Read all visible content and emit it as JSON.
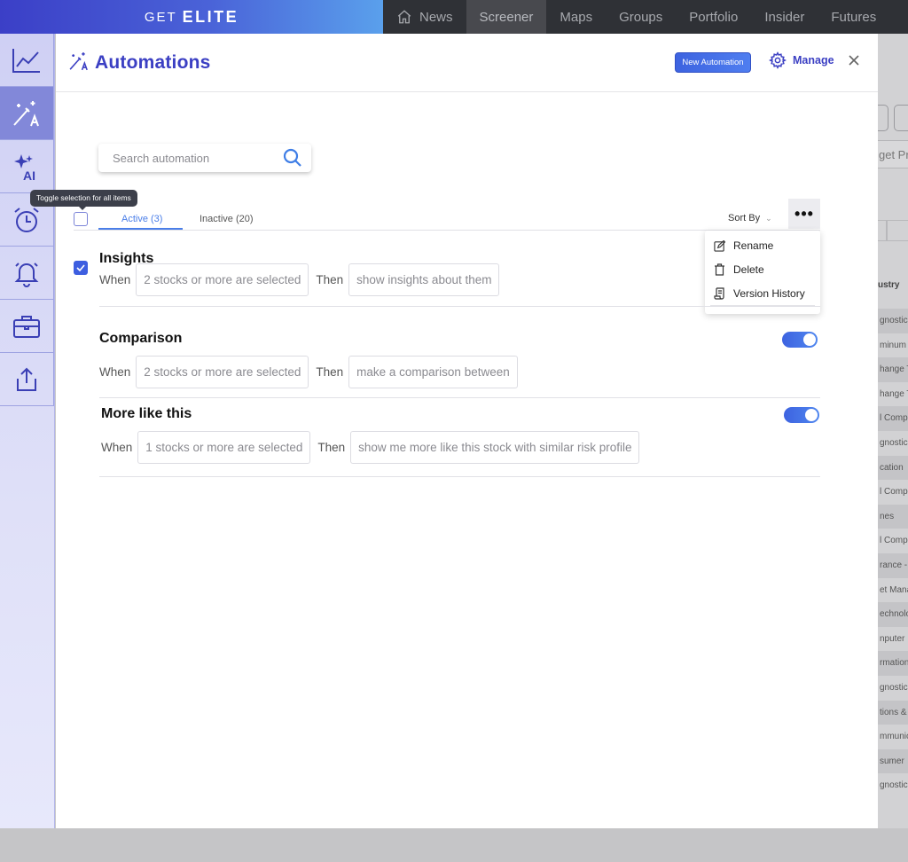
{
  "topbar": {
    "brand_small": "GET",
    "brand_big": "ELITE",
    "nav": [
      {
        "label": "News",
        "icon": "home-icon"
      },
      {
        "label": "Screener",
        "active": true
      },
      {
        "label": "Maps"
      },
      {
        "label": "Groups"
      },
      {
        "label": "Portfolio"
      },
      {
        "label": "Insider"
      },
      {
        "label": "Futures"
      }
    ]
  },
  "sidebar": {
    "items": [
      {
        "icon": "chart-line-icon"
      },
      {
        "icon": "magic-wand-icon",
        "active": true
      },
      {
        "icon": "ai-sparkle-icon"
      },
      {
        "icon": "alarm-clock-icon"
      },
      {
        "icon": "bell-icon"
      },
      {
        "icon": "briefcase-icon"
      },
      {
        "icon": "share-upload-icon"
      }
    ]
  },
  "modal": {
    "title": "Automations",
    "new_button": "New Automation",
    "manage_label": "Manage",
    "search_placeholder": "Search automation",
    "tooltip": "Toggle selection for all items",
    "tabs": {
      "active": "Active (3)",
      "inactive": "Inactive (20)"
    },
    "sort_by": "Sort By",
    "menu": {
      "rename": "Rename",
      "delete": "Delete",
      "version_history": "Version History"
    },
    "when_label": "When",
    "then_label": "Then",
    "automations": [
      {
        "name": "Insights",
        "when": "2 stocks or more are selected",
        "then": "show insights about them",
        "selected": true
      },
      {
        "name": "Comparison",
        "when": "2 stocks or more are selected",
        "then": "make a comparison between",
        "enabled": true
      },
      {
        "name": "More like this",
        "when": "1 stocks or more are selected",
        "then": "show me more like this stock with similar risk profile",
        "enabled": true
      }
    ]
  },
  "background": {
    "search_fragment": "get Pr",
    "column_header": "ustry",
    "column_cells": [
      "gnostics",
      "minum",
      "hange T",
      "hange T",
      "l Comp",
      "gnostics",
      "cation",
      "l Comp",
      "nes",
      "l Comp",
      "rance -",
      "et Mana",
      "echnolo",
      "nputer",
      "rmation",
      "gnostics",
      "tions &",
      "mmunic",
      "sumer",
      "gnostics"
    ]
  },
  "colors": {
    "accent": "#3b3fc3",
    "primary": "#4a7ee8",
    "brand_start": "#3b3fc7",
    "brand_end": "#5aa0ec"
  }
}
